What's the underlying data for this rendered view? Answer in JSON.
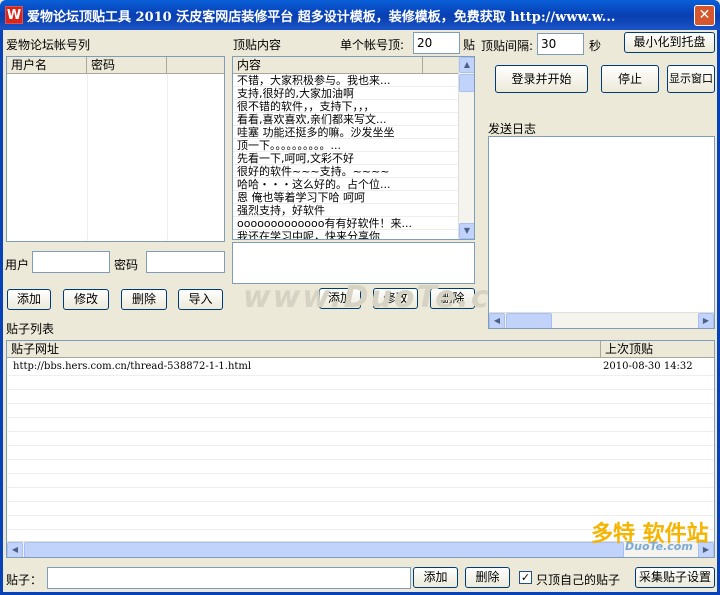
{
  "window": {
    "title": "爱物论坛顶贴工具 2010  沃皮客网店装修平台  超多设计模板，装修模板，免费获取 http://www.w...",
    "close_symbol": "✕",
    "icon_letter": "W"
  },
  "accounts": {
    "section_label": "爱物论坛帐号列",
    "columns": [
      "用户名",
      "密码"
    ],
    "user_label": "用户",
    "user_value": "",
    "password_label": "密码",
    "password_value": "",
    "buttons": {
      "add": "添加",
      "edit": "修改",
      "delete": "删除",
      "import": "导入"
    }
  },
  "content": {
    "section_label": "顶贴内容",
    "per_account_label": "单个帐号顶:",
    "per_account_value": "20",
    "per_account_unit": "贴",
    "column": "内容",
    "items": [
      "不错，大家积极参与。我也来...",
      "支持,很好的,大家加油啊",
      "很不错的软件，，支持下，，，",
      "看看,喜欢喜欢,亲们都来写文...",
      "哇塞 功能还挺多的嘛。沙发坐坐",
      "顶一下。。。。。。。。。。...",
      "先看一下,呵呵,文彩不好",
      "很好的软件~~~支持。~~~~",
      "哈哈・・・这么好的。占个位...",
      "恩 俺也等着学习下哈 呵呵",
      "强烈支持，好软件",
      "ooooooooooooo有有好软件！来...",
      "我还在学习中呢，快来分享你"
    ],
    "editor_value": "",
    "buttons": {
      "add": "添加",
      "edit": "修改",
      "delete": "删除"
    }
  },
  "settings": {
    "interval_label": "顶贴间隔:",
    "interval_value": "30",
    "interval_unit": "秒",
    "minimize_button": "最小化到托盘",
    "login_button": "登录并开始",
    "stop_button": "停止",
    "show_window_button": "显示窗口",
    "log_label": "发送日志"
  },
  "posts": {
    "section_label": "贴子列表",
    "columns": [
      "贴子网址",
      "上次顶贴"
    ],
    "rows": [
      {
        "url": "http://bbs.hers.com.cn/thread-538872-1-1.html",
        "last": "2010-08-30 14:32"
      }
    ]
  },
  "bottom": {
    "post_label": "贴子：",
    "post_value": "",
    "add_button": "添加",
    "delete_button": "删除",
    "only_mine_label": "只顶自己的贴子",
    "only_mine_checked": "✓",
    "collect_button": "采集贴子设置"
  },
  "watermarks": {
    "center": "www.DuoTe.com",
    "corner": "多特 软件站",
    "corner_sub": "DuoTe.com"
  }
}
